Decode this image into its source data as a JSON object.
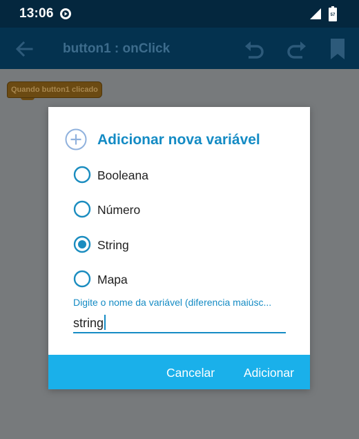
{
  "status_bar": {
    "time": "13:06",
    "battery_level": "57"
  },
  "app_bar": {
    "title": "button1 : onClick"
  },
  "workspace": {
    "event_block_label": "Quando button1 clicado"
  },
  "dialog": {
    "title": "Adicionar nova variável",
    "options": [
      {
        "label": "Booleana",
        "selected": false
      },
      {
        "label": "Número",
        "selected": false
      },
      {
        "label": "String",
        "selected": true
      },
      {
        "label": "Mapa",
        "selected": false
      }
    ],
    "name_field": {
      "hint": "Digite o nome da variável (diferencia maiúsc...",
      "value": "string"
    },
    "cancel_label": "Cancelar",
    "add_label": "Adicionar"
  },
  "colors": {
    "status_bar": "#04273e",
    "app_bar": "#04324f",
    "accent": "#148bc4",
    "action_bar": "#1ab0ea",
    "overlay": "#777a7c",
    "event_block": "#6b4a12"
  },
  "icons": {
    "back": "arrow-back-icon",
    "undo": "undo-icon",
    "redo": "redo-icon",
    "bookmark": "bookmark-icon",
    "dialog": "add-circle-icon",
    "status_app": "play-circle-icon",
    "signal": "signal-icon",
    "battery": "battery-icon"
  }
}
